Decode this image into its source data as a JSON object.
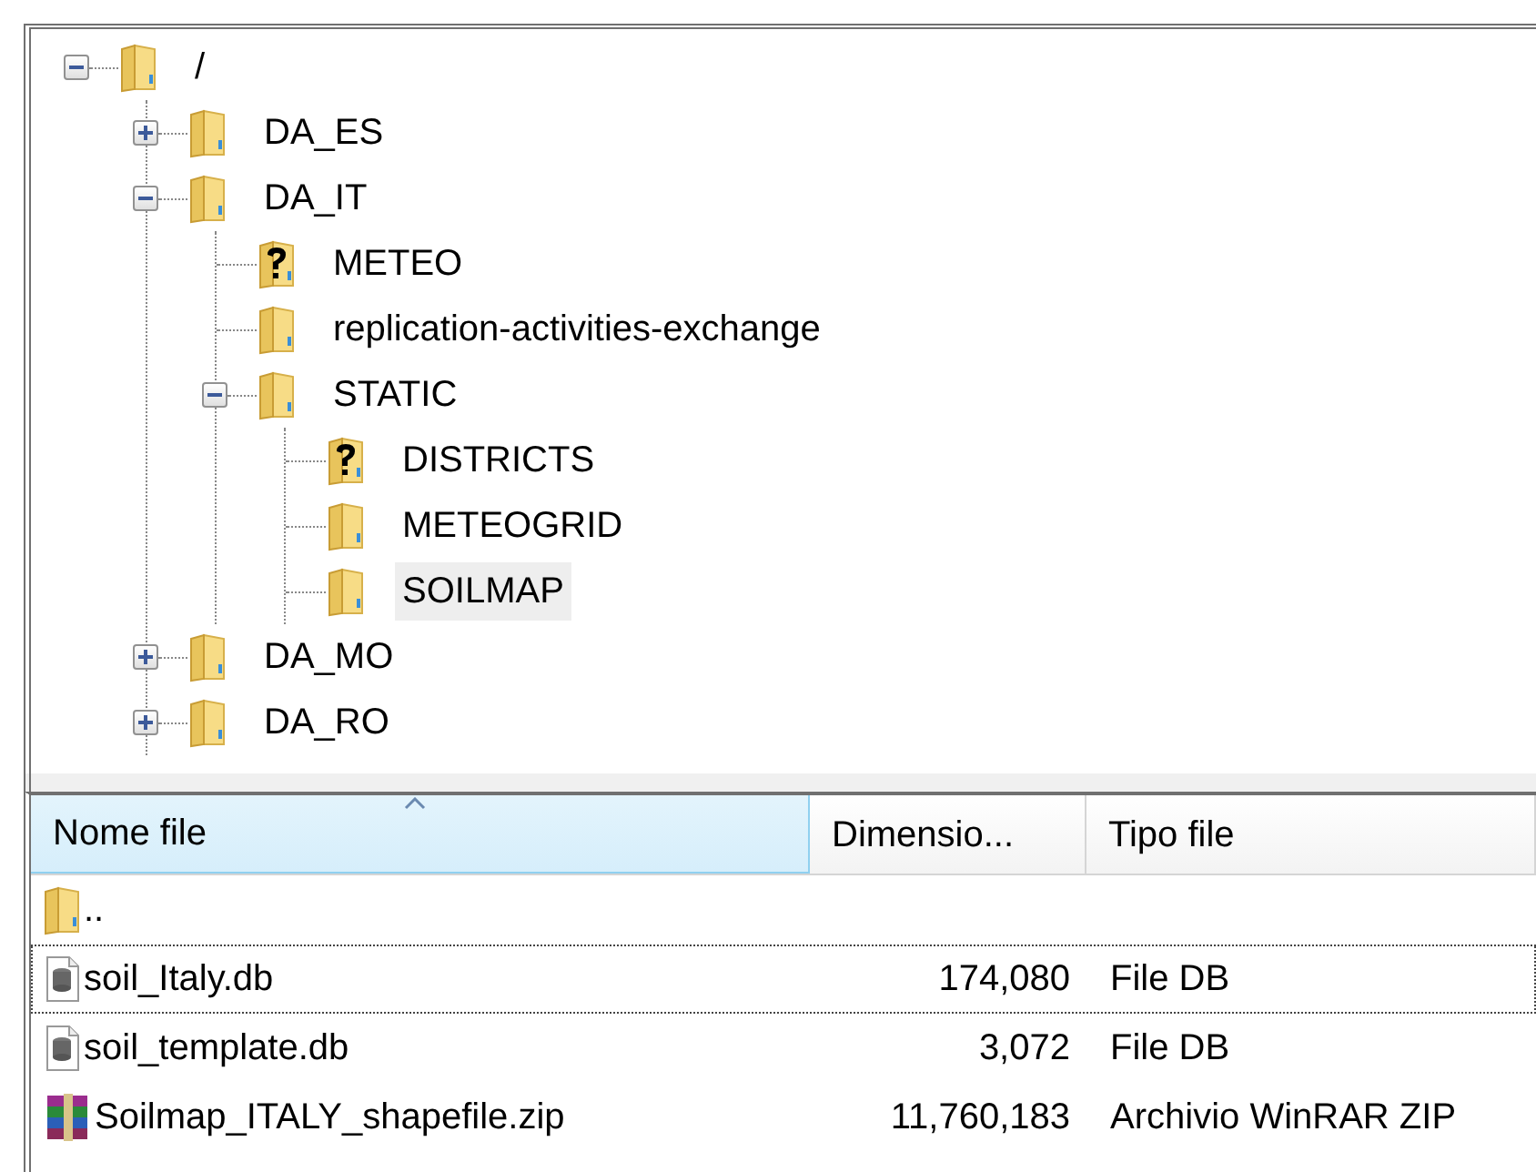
{
  "tree": {
    "name": "/",
    "kind": "folder",
    "expanded": true,
    "selected": false,
    "children": [
      {
        "name": "DA_ES",
        "kind": "folder",
        "expanded": false,
        "selected": false
      },
      {
        "name": "DA_IT",
        "kind": "folder",
        "expanded": true,
        "selected": false,
        "children": [
          {
            "name": "METEO",
            "kind": "unknown",
            "selected": false
          },
          {
            "name": "replication-activities-exchange",
            "kind": "folder",
            "selected": false
          },
          {
            "name": "STATIC",
            "kind": "folder",
            "expanded": true,
            "selected": false,
            "children": [
              {
                "name": "DISTRICTS",
                "kind": "unknown",
                "selected": false
              },
              {
                "name": "METEOGRID",
                "kind": "folder",
                "selected": false
              },
              {
                "name": "SOILMAP",
                "kind": "folder",
                "selected": true
              }
            ]
          }
        ]
      },
      {
        "name": "DA_MO",
        "kind": "folder",
        "expanded": false,
        "selected": false
      },
      {
        "name": "DA_RO",
        "kind": "folder",
        "expanded": false,
        "selected": false
      }
    ]
  },
  "file_list": {
    "columns": [
      {
        "label": "Nome file",
        "sorted": true
      },
      {
        "label": "Dimensio...",
        "sorted": false
      },
      {
        "label": "Tipo file",
        "sorted": false
      }
    ],
    "rows": [
      {
        "kind": "folder",
        "name": "..",
        "focused": false
      },
      {
        "kind": "db",
        "name": "soil_Italy.db",
        "size": "174,080",
        "type": "File DB",
        "focused": true
      },
      {
        "kind": "db",
        "name": "soil_template.db",
        "size": "3,072",
        "type": "File DB",
        "focused": false
      },
      {
        "kind": "archive",
        "name": "Soilmap_ITALY_shapefile.zip",
        "size": "11,760,183",
        "type": "Archivio WinRAR ZIP",
        "focused": false
      }
    ]
  }
}
